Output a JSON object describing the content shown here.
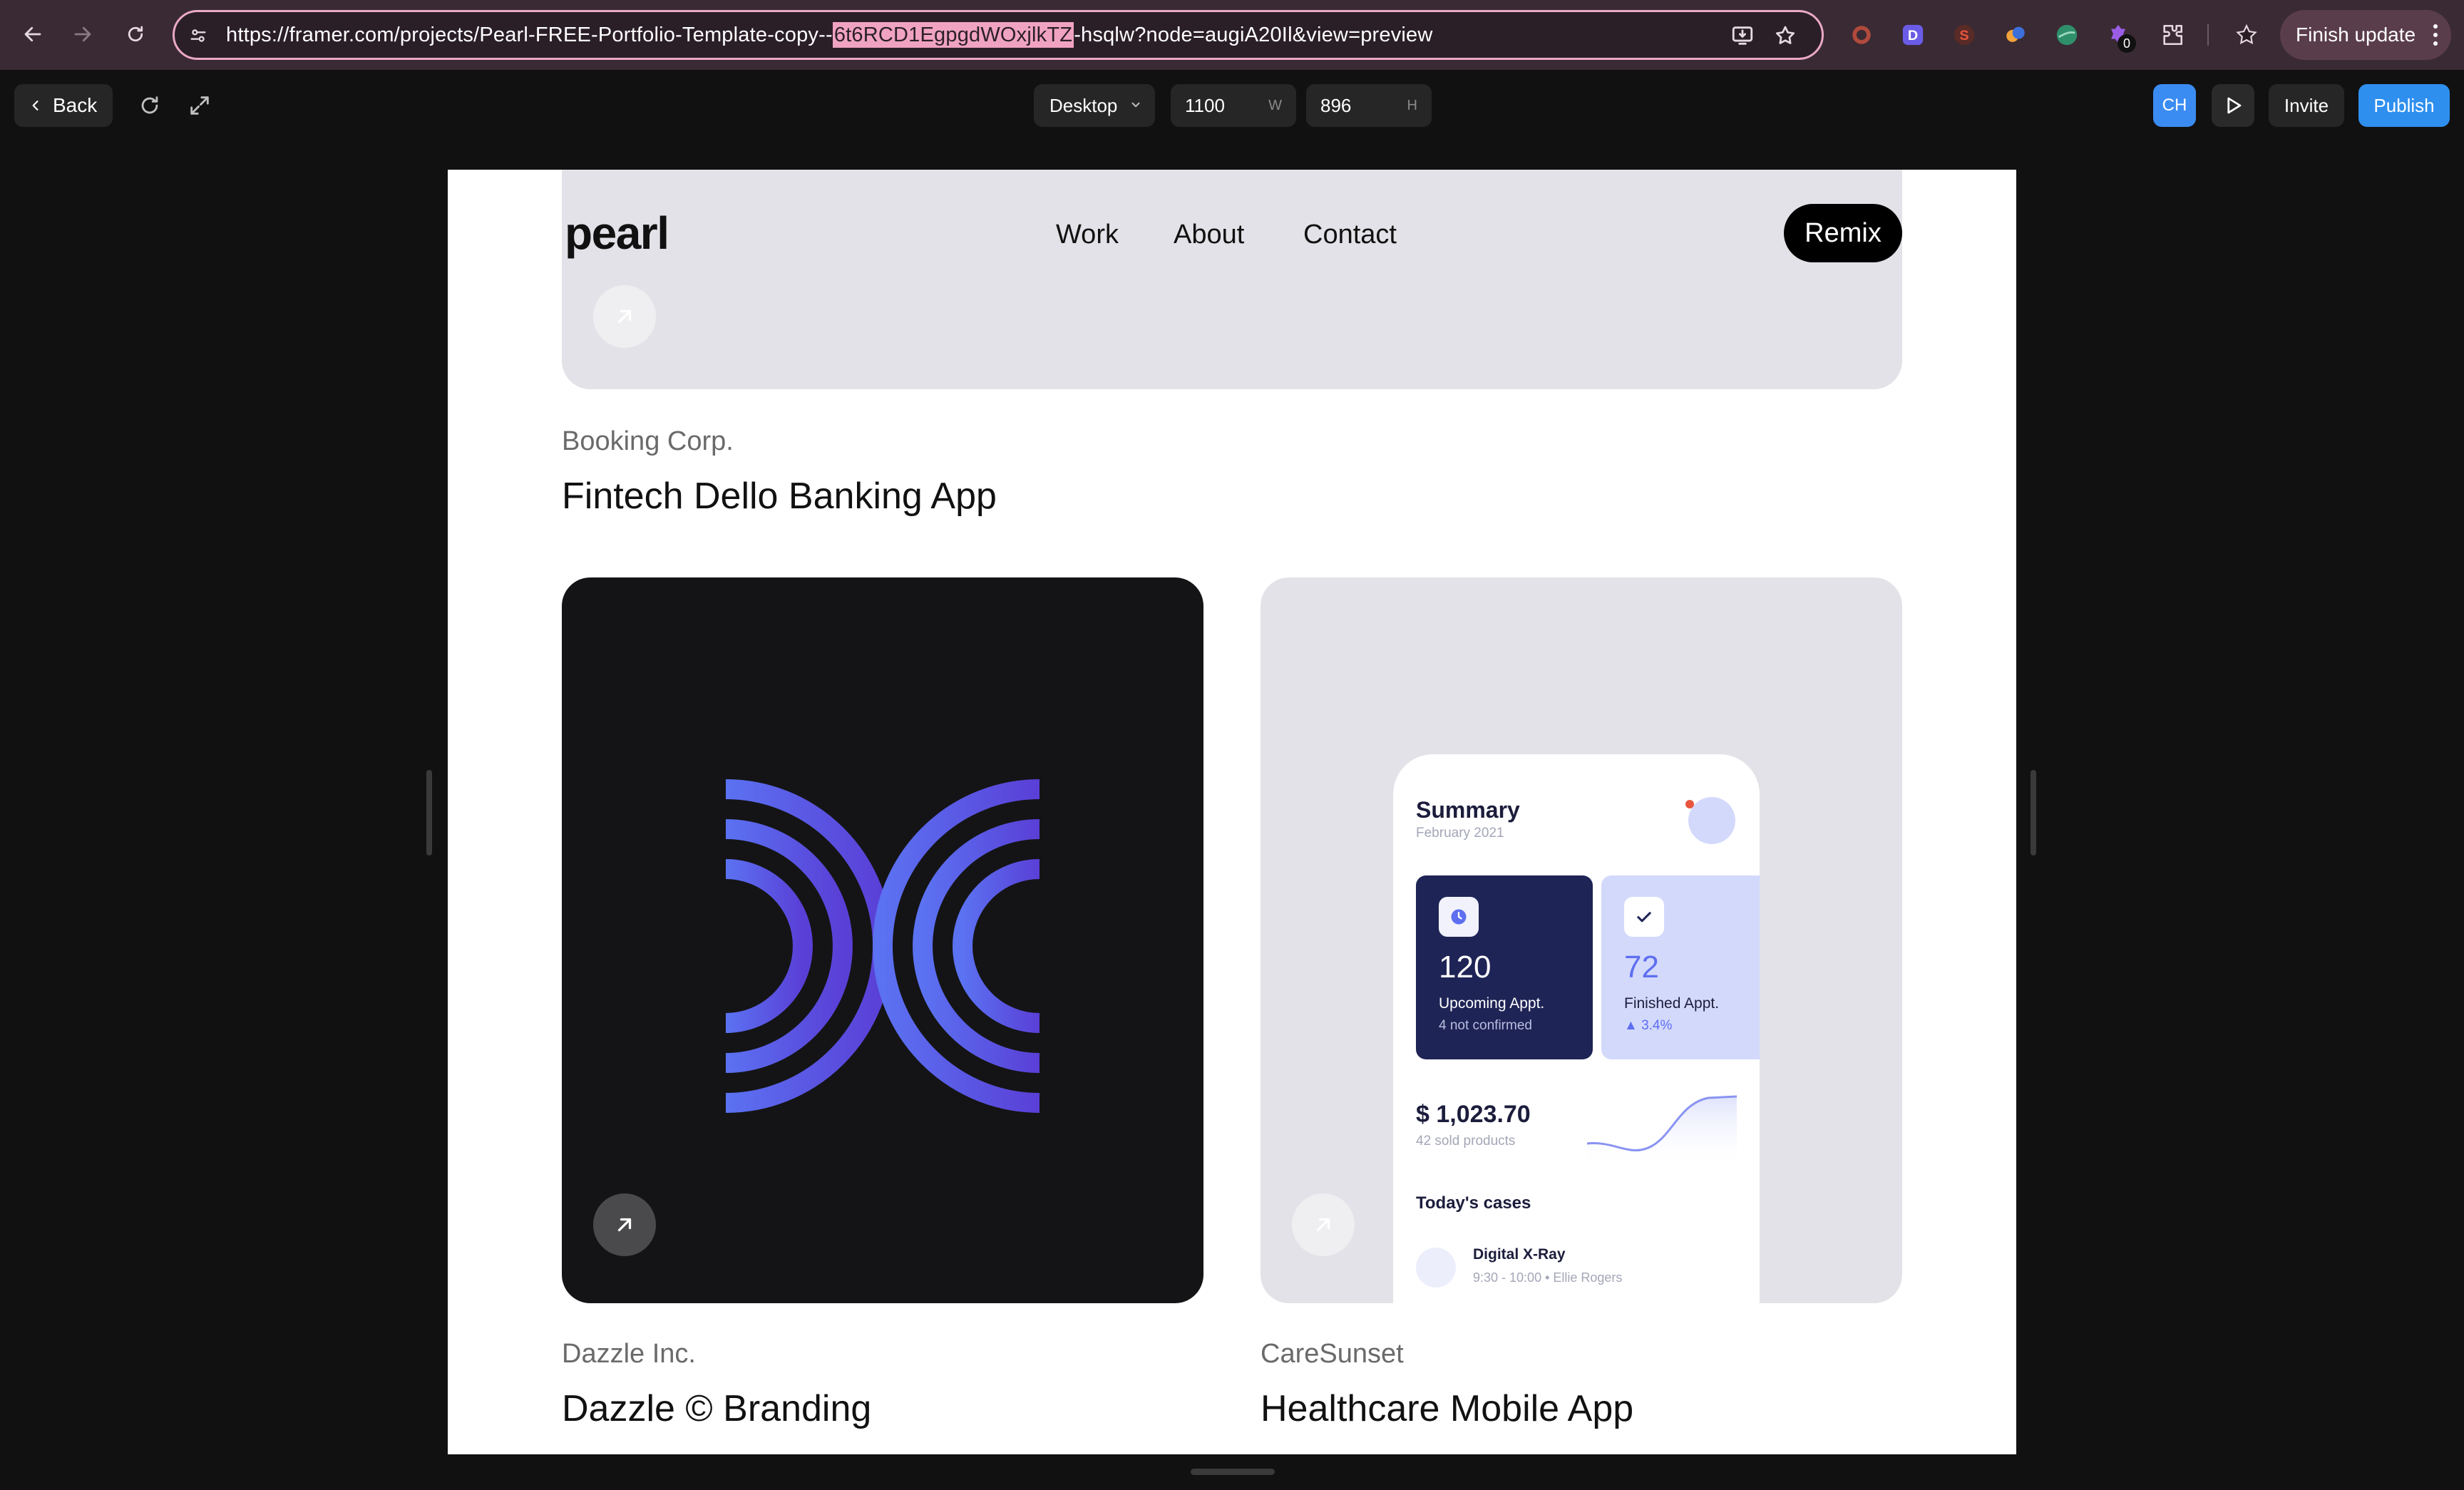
{
  "browser": {
    "url_prefix": "https://framer.com/projects/Pearl-FREE-Portfolio-Template-copy--",
    "url_highlight": "6t6RCD1EgpgdWOxjlkTZ",
    "url_suffix": "-hsqlw?node=augiA20Il&view=preview",
    "extension_badge": "0",
    "finish_update_label": "Finish update",
    "extension_letters": {
      "d": "D",
      "s": "S"
    }
  },
  "toolbar": {
    "back_label": "Back",
    "device_select": "Desktop",
    "width_value": "1100",
    "width_unit": "W",
    "height_value": "896",
    "height_unit": "H",
    "avatar_initials": "CH",
    "invite_label": "Invite",
    "publish_label": "Publish"
  },
  "site": {
    "logo": "pearl",
    "nav": [
      "Work",
      "About",
      "Contact"
    ],
    "remix_label": "Remix",
    "projects": [
      {
        "client": "Booking Corp.",
        "title": "Fintech Dello Banking App"
      },
      {
        "client": "Dazzle Inc.",
        "title": "Dazzle © Branding"
      },
      {
        "client": "CareSunset",
        "title": "Healthcare Mobile App"
      }
    ]
  },
  "phone_mock": {
    "title": "Summary",
    "subtitle": "February 2021",
    "tile1": {
      "number": "120",
      "label": "Upcoming Appt.",
      "sub": "4 not confirmed"
    },
    "tile2": {
      "number": "72",
      "label": "Finished Appt.",
      "sub": "▲  3.4%"
    },
    "amount": "$ 1,023.70",
    "amount_sub": "42 sold products",
    "cases_title": "Today's cases",
    "case_title": "Digital X-Ray",
    "case_time": "9:30 - 10:00  •  Ellie Rogers"
  },
  "colors": {
    "chrome_bg": "#3a2a34",
    "omnibox_border": "#e9a9c4",
    "publish_blue": "#2e8fef",
    "canvas_bg": "#111111",
    "card_gray": "#e2e2e8",
    "dazzle_blue": "#5b6ef0",
    "dazzle_purple": "#5a40d8"
  }
}
